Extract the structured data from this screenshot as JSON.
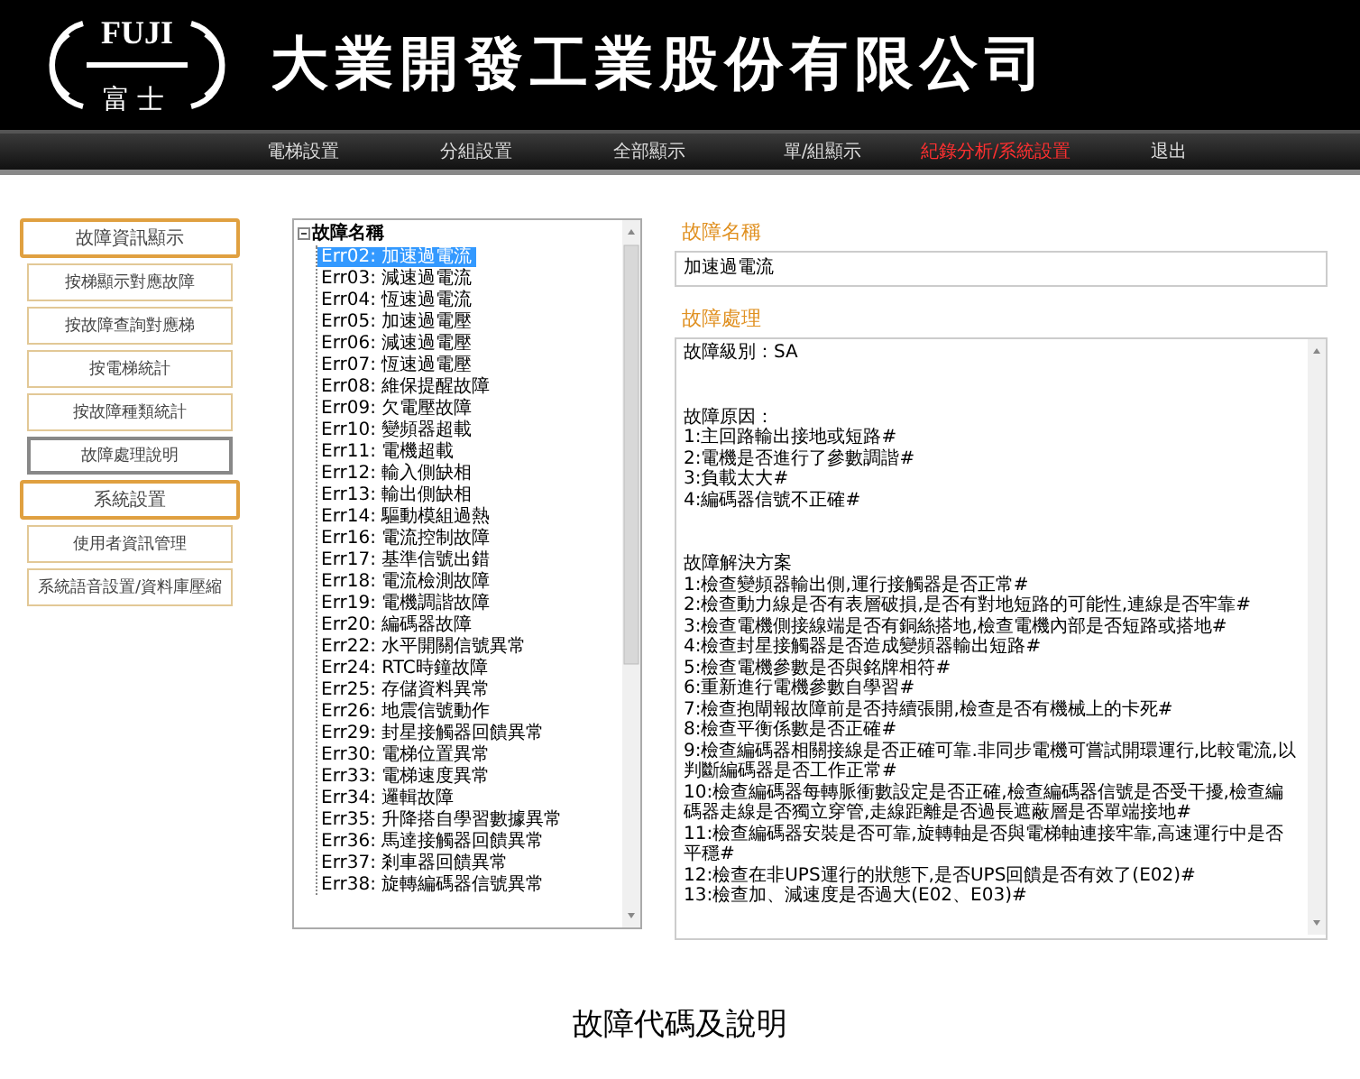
{
  "header": {
    "logo_top": "FUJI",
    "logo_bottom": "富士",
    "company": "大業開發工業股份有限公司"
  },
  "nav": [
    {
      "label": "電梯設置",
      "selected": false
    },
    {
      "label": "分組設置",
      "selected": false
    },
    {
      "label": "全部顯示",
      "selected": false
    },
    {
      "label": "單/組顯示",
      "selected": false
    },
    {
      "label": "紀錄分析/系統設置",
      "selected": true
    },
    {
      "label": "退出",
      "selected": false
    }
  ],
  "sidebar": {
    "items": [
      {
        "label": "故障資訊顯示",
        "kind": "group"
      },
      {
        "label": "按梯顯示對應故障",
        "kind": "item",
        "selected": false
      },
      {
        "label": "按故障查詢對應梯",
        "kind": "item",
        "selected": false
      },
      {
        "label": "按電梯統計",
        "kind": "item",
        "selected": false
      },
      {
        "label": "按故障種類統計",
        "kind": "item",
        "selected": false
      },
      {
        "label": "故障處理說明",
        "kind": "item",
        "selected": true
      },
      {
        "label": "系統設置",
        "kind": "group"
      },
      {
        "label": "使用者資訊管理",
        "kind": "item",
        "selected": false
      },
      {
        "label": "系統語音設置/資料庫壓縮",
        "kind": "item",
        "selected": false
      }
    ]
  },
  "tree": {
    "label": "故障名稱",
    "expanded": true,
    "children": [
      {
        "label": "Err02: 加速過電流",
        "selected": true
      },
      {
        "label": "Err03: 減速過電流",
        "selected": false
      },
      {
        "label": "Err04: 恆速過電流",
        "selected": false
      },
      {
        "label": "Err05: 加速過電壓",
        "selected": false
      },
      {
        "label": "Err06: 減速過電壓",
        "selected": false
      },
      {
        "label": "Err07: 恆速過電壓",
        "selected": false
      },
      {
        "label": "Err08: 維保提醒故障",
        "selected": false
      },
      {
        "label": "Err09: 欠電壓故障",
        "selected": false
      },
      {
        "label": "Err10: 變頻器超載",
        "selected": false
      },
      {
        "label": "Err11: 電機超載",
        "selected": false
      },
      {
        "label": "Err12: 輸入側缺相",
        "selected": false
      },
      {
        "label": "Err13: 輸出側缺相",
        "selected": false
      },
      {
        "label": "Err14: 驅動模組過熱",
        "selected": false
      },
      {
        "label": "Err16: 電流控制故障",
        "selected": false
      },
      {
        "label": "Err17: 基準信號出錯",
        "selected": false
      },
      {
        "label": "Err18: 電流檢測故障",
        "selected": false
      },
      {
        "label": "Err19: 電機調諧故障",
        "selected": false
      },
      {
        "label": "Err20: 編碼器故障",
        "selected": false
      },
      {
        "label": "Err22: 水平開關信號異常",
        "selected": false
      },
      {
        "label": "Err24: RTC時鐘故障",
        "selected": false
      },
      {
        "label": "Err25: 存儲資料異常",
        "selected": false
      },
      {
        "label": "Err26: 地震信號動作",
        "selected": false
      },
      {
        "label": "Err29: 封星接觸器回饋異常",
        "selected": false
      },
      {
        "label": "Err30: 電梯位置異常",
        "selected": false
      },
      {
        "label": "Err33: 電梯速度異常",
        "selected": false
      },
      {
        "label": "Err34: 邏輯故障",
        "selected": false
      },
      {
        "label": "Err35: 升降搭自學習數據異常",
        "selected": false
      },
      {
        "label": "Err36: 馬達接觸器回饋異常",
        "selected": false
      },
      {
        "label": "Err37: 剎車器回饋異常",
        "selected": false
      },
      {
        "label": "Err38: 旋轉編碼器信號異常",
        "selected": false
      }
    ]
  },
  "detail": {
    "name_label": "故障名稱",
    "name_value": "加速過電流",
    "handling_label": "故障處理",
    "handling_sections": [
      [
        "故障級別：SA"
      ],
      [
        "故障原因：",
        "1:主回路輸出接地或短路#",
        "2:電機是否進行了參數調諧#",
        "3:負載太大#",
        "4:編碼器信號不正確#"
      ],
      [
        "故障解決方案",
        "1:檢查變頻器輸出側,運行接觸器是否正常#",
        "2:檢查動力線是否有表層破損,是否有對地短路的可能性,連線是否牢靠#",
        "3:檢查電機側接線端是否有銅絲搭地,檢查電機內部是否短路或搭地#",
        "4:檢查封星接觸器是否造成變頻器輸出短路#",
        "5:檢查電機參數是否與銘牌相符#",
        "6:重新進行電機參數自學習#",
        "7:檢查抱閘報故障前是否持續張開,檢查是否有機械上的卡死#",
        "8:檢查平衡係數是否正確#",
        "9:檢查編碼器相關接線是否正確可靠.非同步電機可嘗試開環運行,比較電流,以判斷編碼器是否工作正常#",
        "10:檢查編碼器每轉脈衝數設定是否正確,檢查編碼器信號是否受干擾,檢查編碼器走線是否獨立穿管,走線距離是否過長遮蔽層是否單端接地#",
        "11:檢查編碼器安裝是否可靠,旋轉軸是否與電梯軸連接牢靠,高速運行中是否平穩#",
        "12:檢查在非UPS運行的狀態下,是否UPS回饋是否有效了(E02)#",
        "13:檢查加、減速度是否過大(E02、E03)#"
      ]
    ]
  },
  "caption": "故障代碼及說明"
}
